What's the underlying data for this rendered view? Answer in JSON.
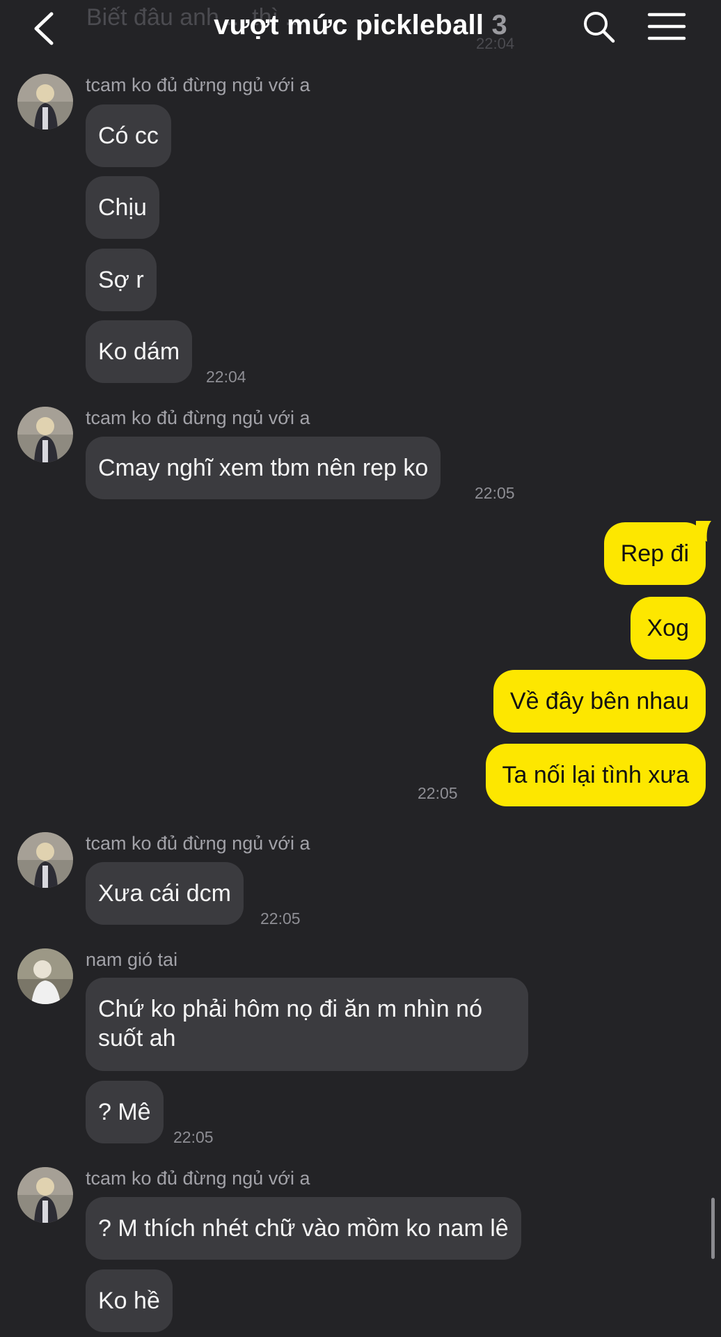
{
  "header": {
    "title": "vượt mức pickleball",
    "member_count": "3",
    "ghost_preview": "Biết đâu anh ... thì ...",
    "ghost_time": "22:04"
  },
  "messages": {
    "g1": {
      "sender": "tcam ko đủ đừng ngủ với a",
      "m1": "Có cc",
      "m2": "Chịu",
      "m3": "Sợ r",
      "m4": "Ko dám",
      "time": "22:04"
    },
    "g2": {
      "sender": "tcam ko đủ đừng ngủ với a",
      "m1": "Cmay nghĩ xem tbm nên rep ko",
      "time": "22:05"
    },
    "mine": {
      "m1": "Rep đi",
      "m2": "Xog",
      "m3": "Về đây bên nhau",
      "m4": "Ta nối lại tình xưa",
      "time": "22:05"
    },
    "g3": {
      "sender": "tcam ko đủ đừng ngủ với a",
      "m1": "Xưa cái dcm",
      "time": "22:05"
    },
    "g4": {
      "sender": "nam gió tai",
      "m1": "Chứ ko phải hôm nọ đi ăn m nhìn nó suốt ah",
      "m2": "? Mê",
      "time": "22:05"
    },
    "g5": {
      "sender": "tcam ko đủ đừng ngủ với a",
      "m1": "? M thích nhét chữ vào mồm ko nam lê",
      "m2": "Ko hề"
    }
  },
  "colors": {
    "background": "#232326",
    "incoming_bubble": "#3b3b3f",
    "outgoing_bubble": "#fde700"
  },
  "icons": [
    "back-arrow-icon",
    "search-icon",
    "menu-icon"
  ]
}
